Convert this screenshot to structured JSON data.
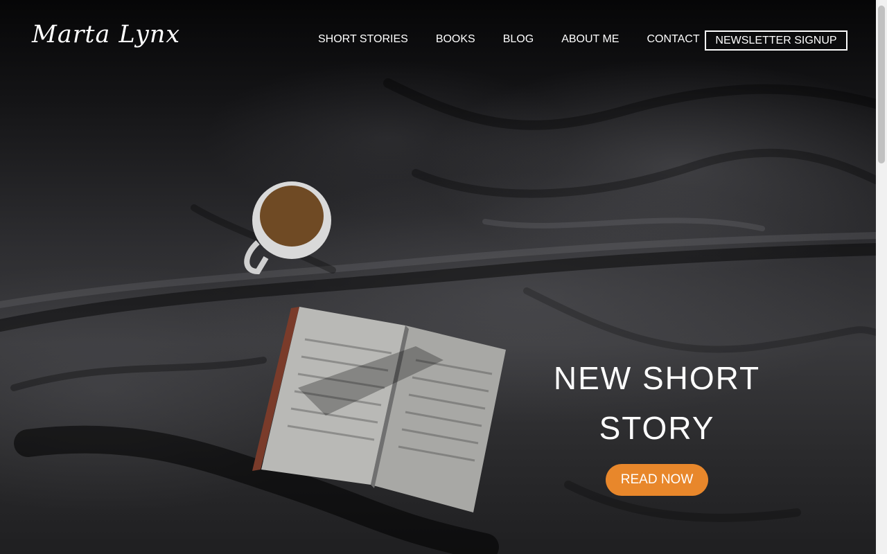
{
  "brand": {
    "logo_text": "Marta Lynx"
  },
  "nav": {
    "items": [
      {
        "label": "SHORT STORIES"
      },
      {
        "label": "BOOKS"
      },
      {
        "label": "BLOG"
      },
      {
        "label": "ABOUT ME"
      },
      {
        "label": "CONTACT"
      }
    ],
    "newsletter_label": "NEWSLETTER SIGNUP"
  },
  "hero": {
    "title_line1": "NEW SHORT",
    "title_line2": "STORY",
    "cta_label": "READ NOW",
    "cta_color": "#e8872b",
    "image_icon": "coffee-cup-and-open-book-on-bed-image"
  }
}
